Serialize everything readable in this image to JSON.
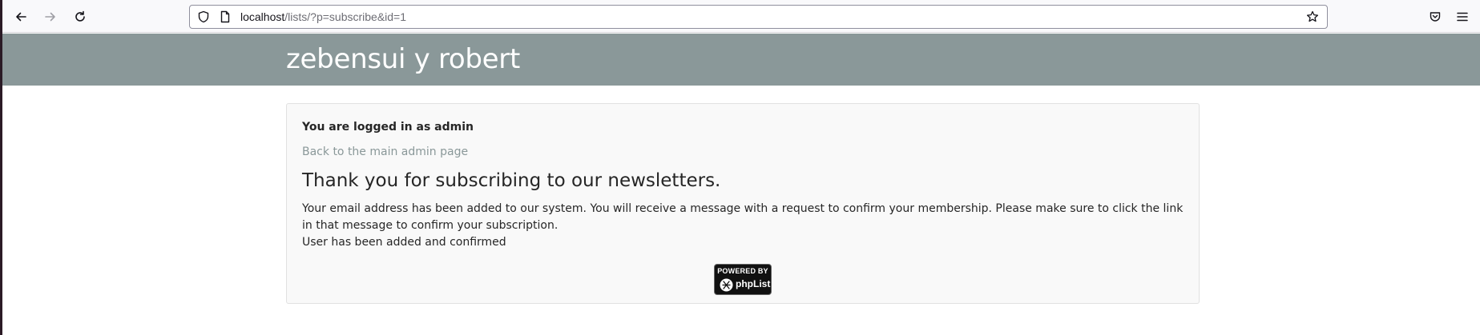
{
  "browser": {
    "url_host": "localhost",
    "url_path": "/lists/?p=subscribe&id=1"
  },
  "site": {
    "title": "zebensui y robert"
  },
  "panel": {
    "logged_in": "You are logged in as admin",
    "back_link": "Back to the main admin page",
    "heading": "Thank you for subscribing to our newsletters.",
    "message_line1": "Your email address has been added to our system. You will receive a message with a request to confirm your membership. Please make sure to click the link in that message to confirm your subscription.",
    "message_line2": "User has been added and confirmed"
  },
  "badge": {
    "powered_by": "POWERED BY",
    "brand": "phpList"
  },
  "colors": {
    "header_bg": "#8a9899",
    "link": "#8a9899",
    "panel_bg": "#f9f9f9"
  },
  "icons": [
    "back-arrow-icon",
    "forward-arrow-icon",
    "reload-icon",
    "shield-icon",
    "page-icon",
    "star-icon",
    "pocket-icon",
    "menu-icon",
    "phplist-logo-icon"
  ]
}
